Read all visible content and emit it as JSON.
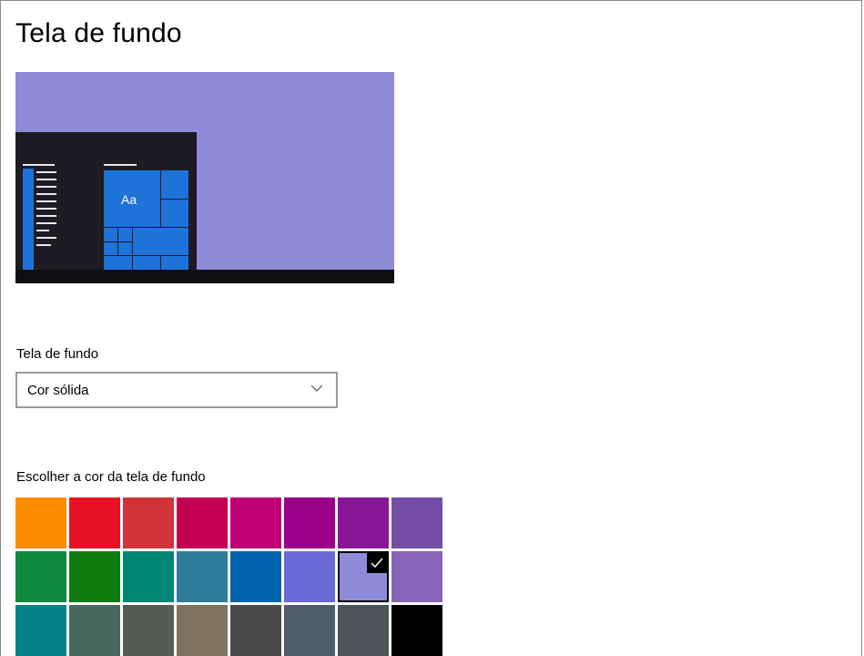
{
  "page": {
    "title": "Tela de fundo"
  },
  "preview": {
    "sample_text": "Aa",
    "bg_color": "#8e8bd8",
    "accent_color": "#1e73d8"
  },
  "background_select": {
    "label": "Tela de fundo",
    "value": "Cor sólida"
  },
  "colors": {
    "label": "Escolher a cor da tela de fundo",
    "selected": "#8e8bd8",
    "swatches": [
      [
        "#ff8c00",
        "#e81123",
        "#d13438",
        "#c30052",
        "#bf0077",
        "#9a0089",
        "#881798",
        "#744da9"
      ],
      [
        "#10893e",
        "#107c10",
        "#018574",
        "#2d7d9a",
        "#0063b1",
        "#6b69d6",
        "#8e8bd8",
        "#8764b8"
      ],
      [
        "#038387",
        "#486860",
        "#525e54",
        "#7e735f",
        "#4c4a48",
        "#515c6b",
        "#4a5459",
        "#000000"
      ]
    ]
  }
}
